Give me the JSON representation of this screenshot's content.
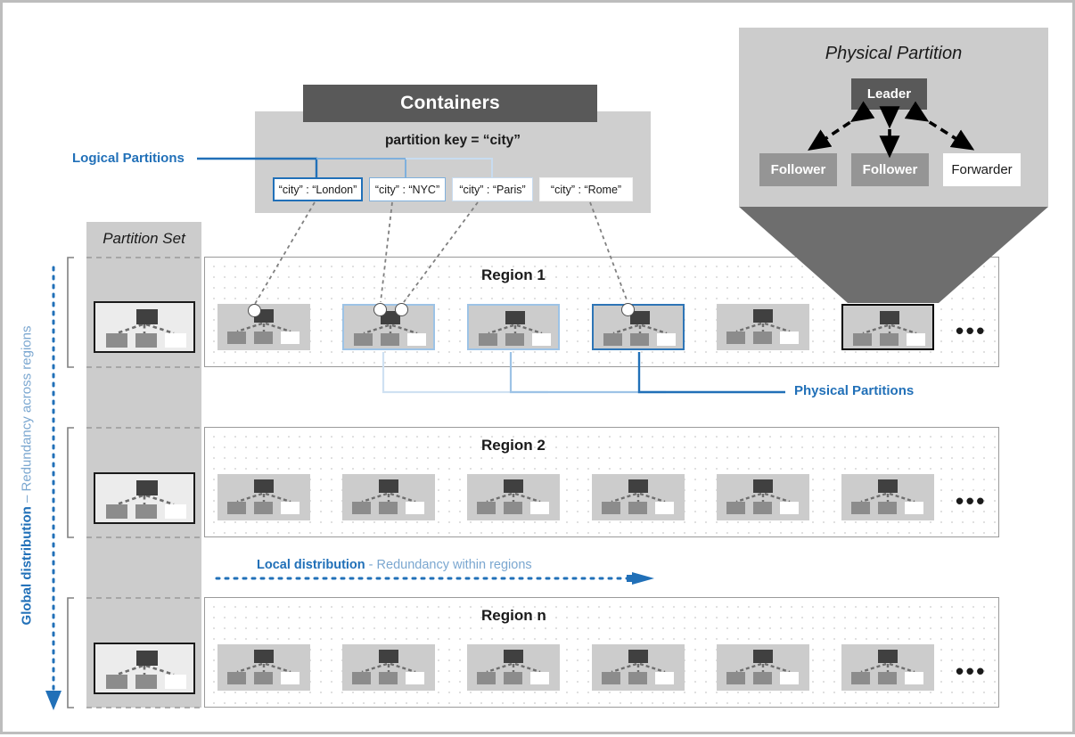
{
  "containers": {
    "header_label": "Containers",
    "partition_key_label": "partition key = “city”",
    "logical_partitions_label": "Logical Partitions",
    "city_boxes": [
      {
        "label": "“city” : “London”"
      },
      {
        "label": "“city” : “NYC”"
      },
      {
        "label": "“city” : “Paris”"
      },
      {
        "label": "“city” : “Rome”"
      }
    ]
  },
  "physical_partition": {
    "title": "Physical Partition",
    "leader_label": "Leader",
    "follower_1_label": "Follower",
    "follower_2_label": "Follower",
    "forwarder_label": "Forwarder"
  },
  "partition_set": {
    "title": "Partition Set"
  },
  "regions": [
    {
      "title": "Region 1",
      "ellipsis": "•••"
    },
    {
      "title": "Region 2",
      "ellipsis": "•••"
    },
    {
      "title": "Region n",
      "ellipsis": "•••"
    }
  ],
  "annotations": {
    "global_distribution_bold": "Global distribution",
    "global_distribution_light": "– Redundancy across regions",
    "local_distribution_bold": "Local distribution",
    "local_distribution_light": "- Redundancy within regions",
    "physical_partitions_label": "Physical Partitions"
  },
  "colors": {
    "accent_blue": "#2170b8",
    "light_blue": "#9dc3e6",
    "mid_blue": "#2e75b6",
    "panel_gray": "#cccccc",
    "header_gray": "#595959",
    "leader_gray": "#404040",
    "follower_gray": "#8c8c8c"
  }
}
